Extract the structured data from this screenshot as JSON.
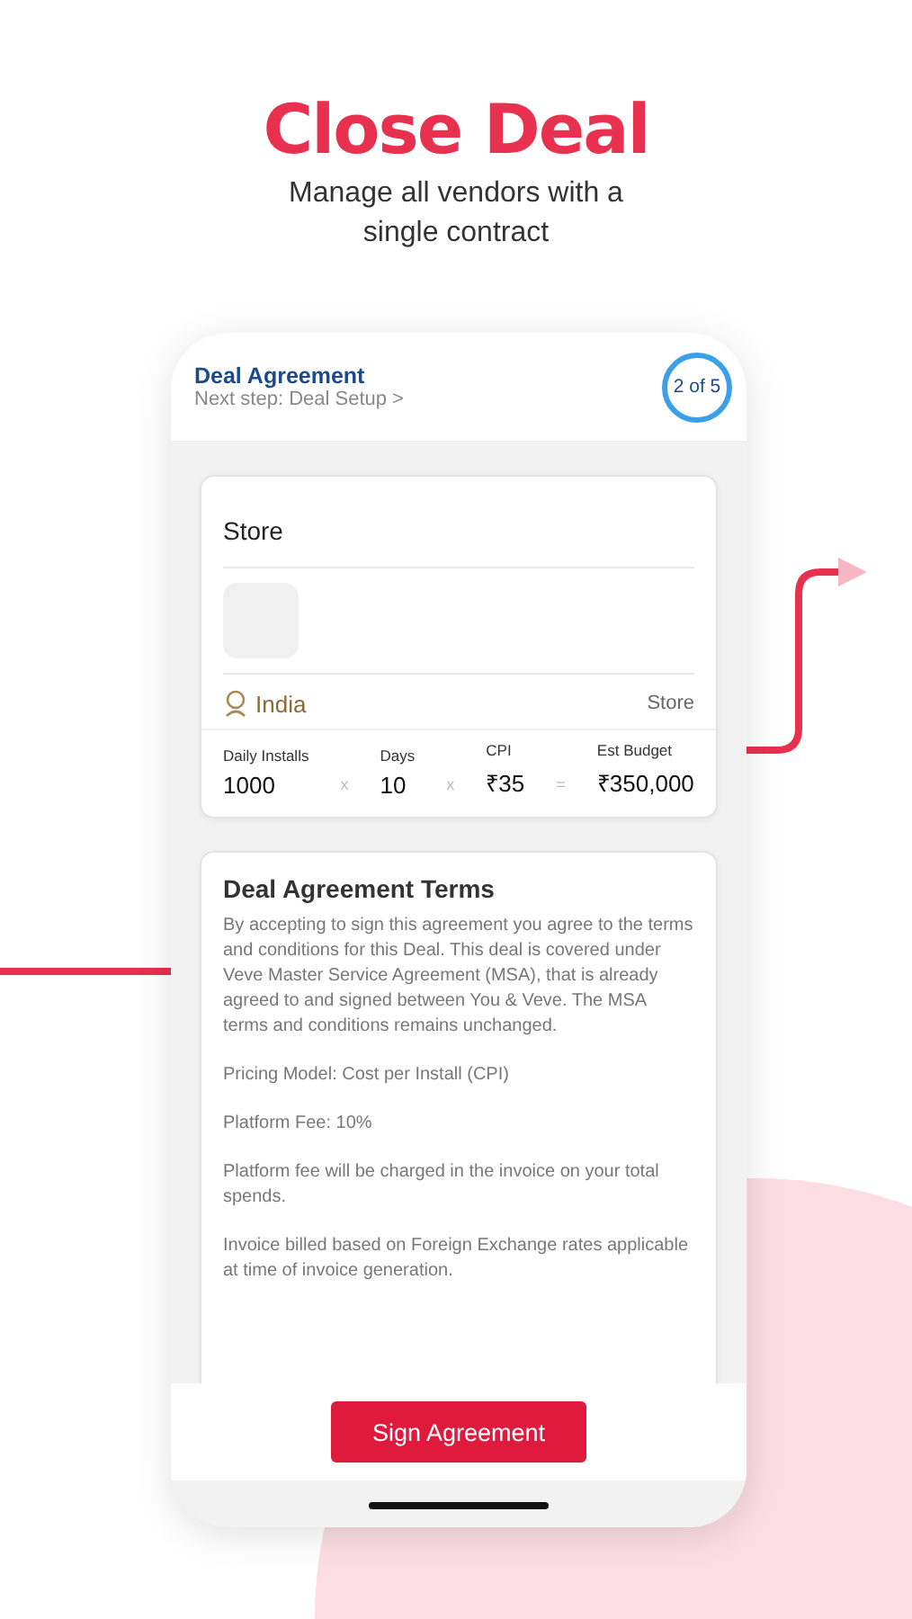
{
  "headline": "Close Deal",
  "subtitle": "Manage all vendors with a single contract",
  "header": {
    "title": "Deal Agreement",
    "next_step": "Next step: Deal Setup >",
    "step": "2 of 5"
  },
  "store_card": {
    "title": "Store",
    "country": "India",
    "type": "Store",
    "metrics": [
      {
        "label": "Daily Installs",
        "value": "1000",
        "operator": "x"
      },
      {
        "label": "Days",
        "value": "10",
        "operator": "x"
      },
      {
        "label": "CPI",
        "value": "₹35",
        "operator": "="
      },
      {
        "label": "Est Budget",
        "value": "₹350,000"
      }
    ]
  },
  "terms": {
    "title": "Deal Agreement Terms",
    "paragraphs": [
      "By accepting to sign this agreement you agree to the terms and conditions for this Deal. This deal is covered under Veve Master Service Agreement (MSA), that is already agreed to and signed between You & Veve. The MSA terms and conditions remains unchanged.",
      "Pricing Model: Cost per Install (CPI)",
      "Platform Fee: 10%",
      "Platform fee will be charged in the invoice on your total spends.",
      "Invoice billed based on Foreign Exchange rates applicable at time of invoice generation."
    ]
  },
  "sign_button": "Sign Agreement"
}
